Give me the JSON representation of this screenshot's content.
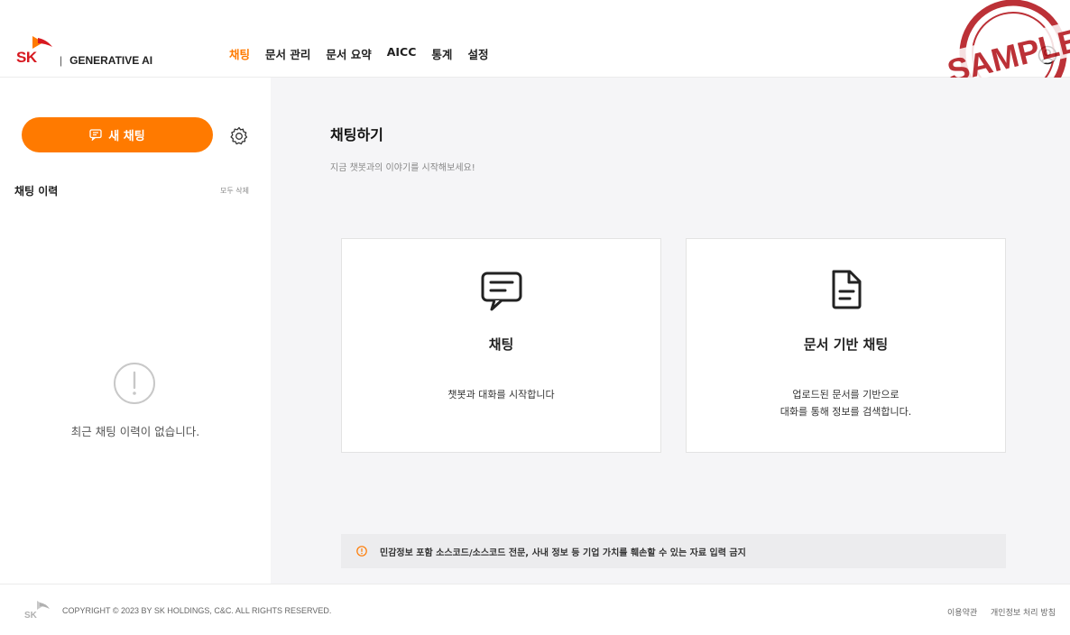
{
  "header": {
    "logo_text": "SK",
    "brand": "GENERATIVE AI",
    "brand_separator": "|",
    "nav": [
      {
        "label": "채팅",
        "active": true
      },
      {
        "label": "문서 관리",
        "active": false
      },
      {
        "label": "문서 요약",
        "active": false
      },
      {
        "label": "AICC",
        "active": false
      },
      {
        "label": "통계",
        "active": false
      },
      {
        "label": "설정",
        "active": false
      }
    ],
    "stamp_text": "SAMPLE",
    "user_icon": "user-circle-icon"
  },
  "sidebar": {
    "new_chat_label": "새 채팅",
    "history_title": "채팅 이력",
    "delete_all": "모두 삭제",
    "empty_text": "최근 채팅 이력이 없습니다."
  },
  "main": {
    "title": "채팅하기",
    "subtitle": "지금 챗봇과의 이야기를 시작해보세요!",
    "cards": [
      {
        "icon": "chat-bubble-icon",
        "title": "채팅",
        "desc_lines": [
          "챗봇과 대화를 시작합니다"
        ]
      },
      {
        "icon": "document-icon",
        "title": "문서 기반 채팅",
        "desc_lines": [
          "업로드된 문서를 기반으로",
          "대화를 통해 정보를 검색합니다."
        ]
      }
    ],
    "notice": "민감정보 포함 소스코드/소스코드 전문, 사내 정보 등 기업 가치를 훼손할 수 있는 자료 입력 금지"
  },
  "footer": {
    "copyright": "COPYRIGHT © 2023 BY SK HOLDINGS, C&C. ALL RIGHTS RESERVED.",
    "links": [
      "이용약관",
      "개인정보 처리 방침"
    ]
  },
  "colors": {
    "accent": "#ff7a00",
    "logo_red": "#d71920",
    "stamp_red": "#b3151c",
    "main_bg": "#f5f5f7"
  }
}
